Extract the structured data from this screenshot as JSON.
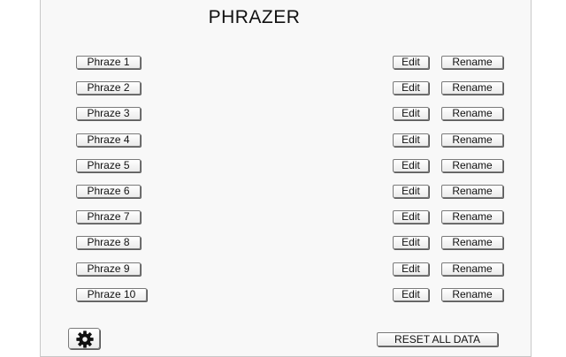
{
  "app": {
    "title": "PHRAZER"
  },
  "phrazes": [
    {
      "label": "Phraze 1",
      "edit_label": "Edit",
      "rename_label": "Rename"
    },
    {
      "label": "Phraze 2",
      "edit_label": "Edit",
      "rename_label": "Rename"
    },
    {
      "label": "Phraze 3",
      "edit_label": "Edit",
      "rename_label": "Rename"
    },
    {
      "label": "Phraze 4",
      "edit_label": "Edit",
      "rename_label": "Rename"
    },
    {
      "label": "Phraze 5",
      "edit_label": "Edit",
      "rename_label": "Rename"
    },
    {
      "label": "Phraze 6",
      "edit_label": "Edit",
      "rename_label": "Rename"
    },
    {
      "label": "Phraze 7",
      "edit_label": "Edit",
      "rename_label": "Rename"
    },
    {
      "label": "Phraze 8",
      "edit_label": "Edit",
      "rename_label": "Rename"
    },
    {
      "label": "Phraze 9",
      "edit_label": "Edit",
      "rename_label": "Rename"
    },
    {
      "label": "Phraze 10",
      "edit_label": "Edit",
      "rename_label": "Rename"
    }
  ],
  "footer": {
    "settings_icon": "gear-icon",
    "reset_label": "RESET ALL DATA"
  }
}
